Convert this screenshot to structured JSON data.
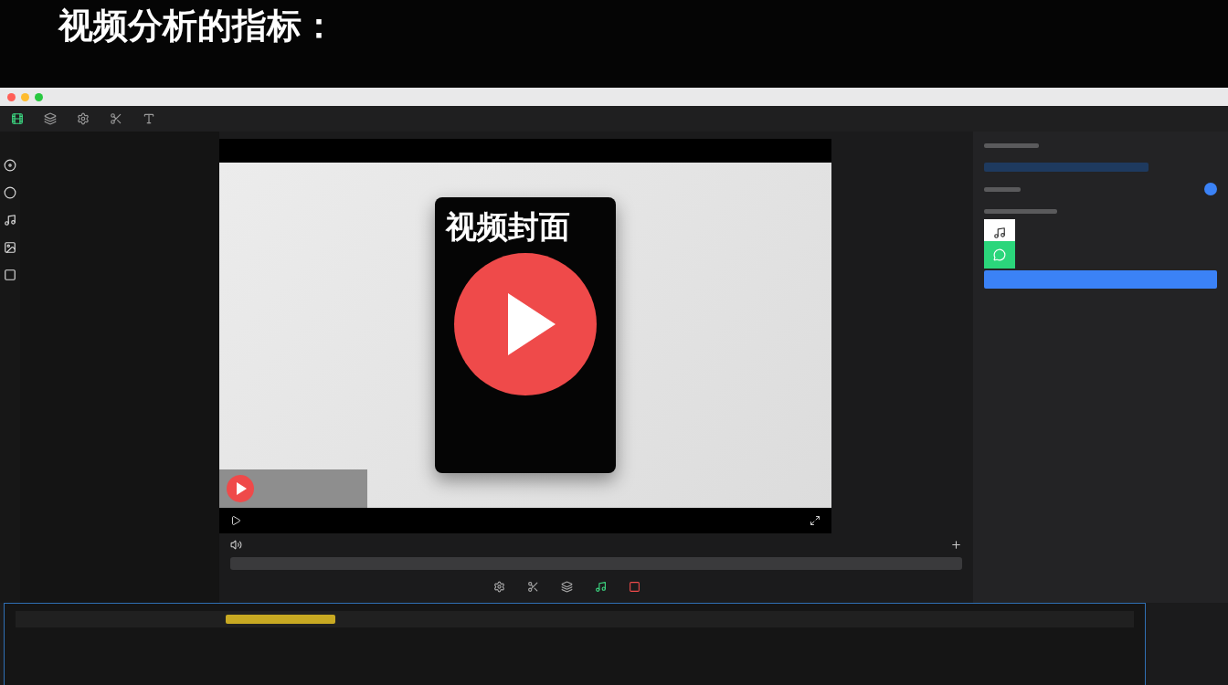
{
  "headline": "视频分析的指标：",
  "preview": {
    "cover_title": "视频封面"
  },
  "properties": {
    "toggle": {
      "on": true
    }
  }
}
